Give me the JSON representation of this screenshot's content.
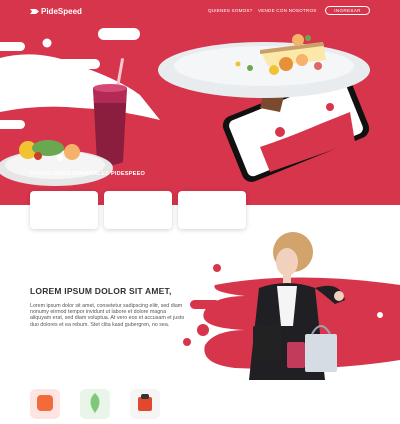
{
  "brand": {
    "name": "PideSpeed"
  },
  "nav": {
    "items": [
      {
        "label": "QUIENES SOMOS?"
      },
      {
        "label": "VENDE CON NOSOTROS"
      }
    ],
    "login_label": "INGRESAR"
  },
  "promotions": {
    "title": "POMOCIONES SEMANALES PIDESPEEO",
    "cards": [
      {},
      {},
      {}
    ]
  },
  "about": {
    "title": "LOREM IPSUM DOLOR SIT AMET,",
    "body": "Lorem ipsum dolor sit amet, consetetur sadipscing elitr, sed diam nonumy eirmod tempor invidunt ut labore et dolore magna aliquyam erat, sed diam voluptua. At vero eos et accusam et justo duo dolores et ea rebum. Stet clita kasd gubergren, no sea."
  },
  "features": [
    {},
    {},
    {}
  ],
  "colors": {
    "brand_red": "#d7354c",
    "white": "#ffffff",
    "heading_text": "#333333",
    "body_text": "#555555"
  }
}
